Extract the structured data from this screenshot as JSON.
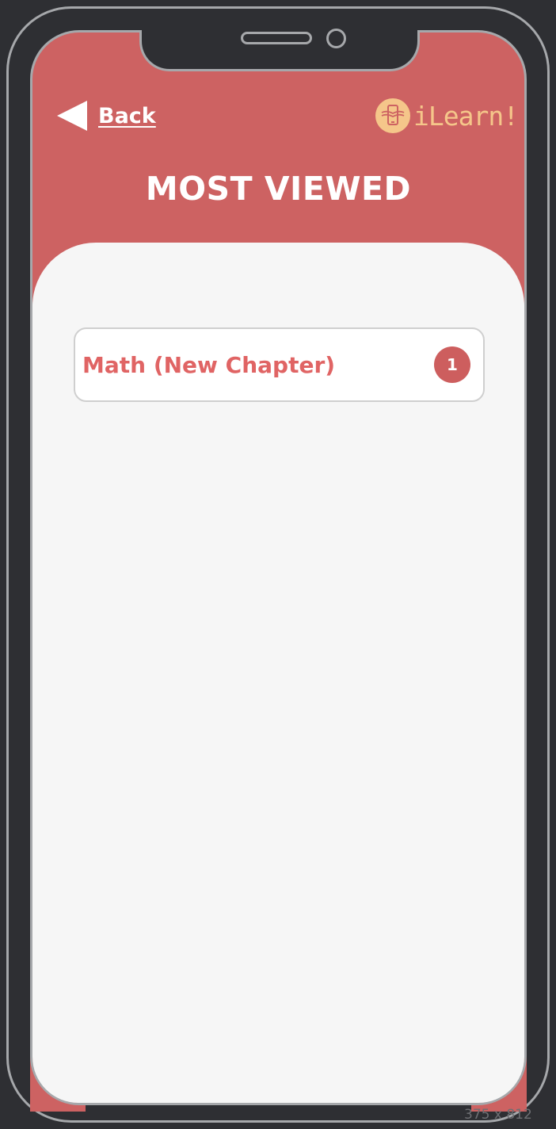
{
  "header": {
    "back_label": "Back",
    "logo_text": "iLearn!",
    "title": "MOST VIEWED"
  },
  "list": {
    "items": [
      {
        "label": "Math (New Chapter)",
        "count": "1"
      }
    ]
  },
  "frame": {
    "dimensions_label": "375 x 812"
  },
  "colors": {
    "header_bg": "#cd6262",
    "content_bg": "#f6f6f6",
    "item_text": "#e06464",
    "badge_bg": "#cd5e5e",
    "logo": "#f5c68a",
    "frame_bg": "#2e2f33",
    "frame_stroke": "#a6a8ab"
  },
  "icons": {
    "back": "back-arrow-icon",
    "logo": "phone-book-icon"
  }
}
